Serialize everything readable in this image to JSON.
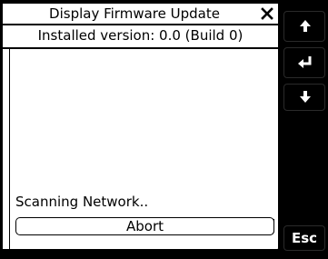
{
  "dialog": {
    "title": "Display Firmware Update",
    "close_icon": "close-icon",
    "installed_version": "Installed version: 0.0 (Build 0)",
    "status": "Scanning Network..",
    "abort_label": "Abort",
    "resize_icon": "resize-grip-icon"
  },
  "side_buttons": {
    "up_icon": "arrow-up-icon",
    "enter_icon": "enter-icon",
    "down_icon": "arrow-down-icon",
    "esc_label": "Esc"
  },
  "colors": {
    "screen_background": "#ffffff",
    "bezel": "#000000",
    "text": "#000000",
    "button_text": "#ffffff"
  }
}
